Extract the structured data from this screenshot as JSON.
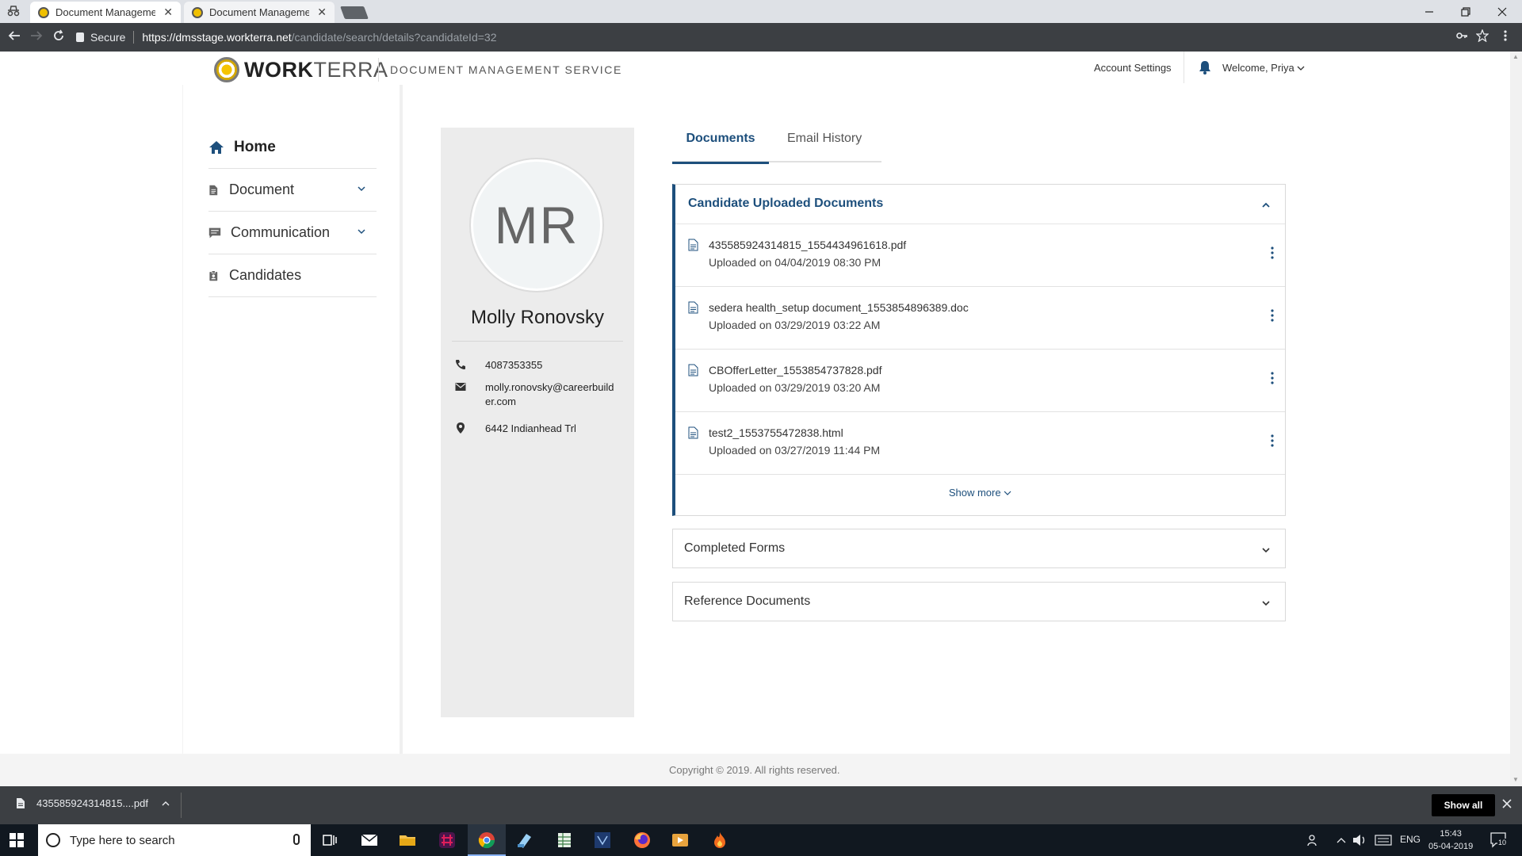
{
  "browser": {
    "tabs": [
      {
        "label": "Document Management",
        "active": true
      },
      {
        "label": "Document Management",
        "active": false
      }
    ],
    "close_glyph": "✕",
    "secure_label": "Secure",
    "url_host": "https://dmsstage.workterra.net",
    "url_path": "/candidate/search/details?candidateId=32"
  },
  "header": {
    "logo_bold": "WORK",
    "logo_light": "TERRA",
    "service_title": "DOCUMENT MANAGEMENT SERVICE",
    "account_settings": "Account Settings",
    "welcome": "Welcome, Priya"
  },
  "sidebar": {
    "items": [
      {
        "label": "Home",
        "icon": "home-icon"
      },
      {
        "label": "Document",
        "icon": "document-icon"
      },
      {
        "label": "Communication",
        "icon": "chat-icon"
      },
      {
        "label": "Candidates",
        "icon": "candidate-badge-icon"
      }
    ]
  },
  "candidate": {
    "initials": "MR",
    "name": "Molly Ronovsky",
    "phone": "4087353355",
    "email": "molly.ronovsky@careerbuilder.com",
    "address": "6442 Indianhead Trl"
  },
  "tabs": {
    "documents": "Documents",
    "email_history": "Email History"
  },
  "uploaded": {
    "title": "Candidate Uploaded Documents",
    "documents": [
      {
        "name": "435585924314815_1554434961618.pdf",
        "uploaded": "Uploaded on 04/04/2019 08:30 PM"
      },
      {
        "name": "sedera health_setup document_1553854896389.doc",
        "uploaded": "Uploaded on 03/29/2019 03:22 AM"
      },
      {
        "name": "CBOfferLetter_1553854737828.pdf",
        "uploaded": "Uploaded on 03/29/2019 03:20 AM"
      },
      {
        "name": "test2_1553755472838.html",
        "uploaded": "Uploaded on 03/27/2019 11:44 PM"
      }
    ],
    "show_more": "Show more"
  },
  "completed_forms": {
    "title": "Completed Forms"
  },
  "reference_documents": {
    "title": "Reference Documents"
  },
  "footer": {
    "copyright": "Copyright © 2019. All rights reserved."
  },
  "downloads": {
    "file": "435585924314815....pdf",
    "show_all": "Show all"
  },
  "taskbar": {
    "search_placeholder": "Type here to search",
    "language": "ENG",
    "time": "15:43",
    "date": "05-04-2019",
    "notification_count": "10"
  },
  "colors": {
    "accent": "#1d4f7c",
    "card_bg": "#ececec",
    "chrome_dark": "#3c3f43"
  }
}
